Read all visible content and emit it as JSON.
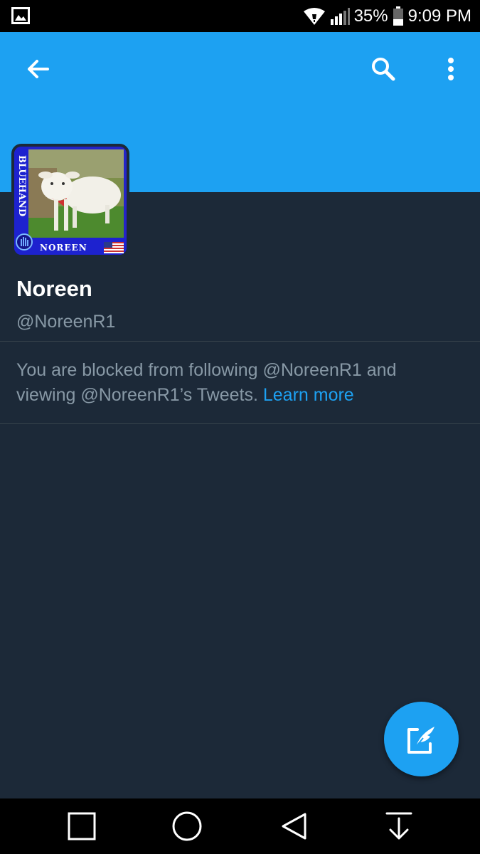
{
  "status_bar": {
    "battery_percent": "35%",
    "time": "9:09 PM",
    "icons": [
      "gallery-icon",
      "wifi-icon",
      "signal-icon",
      "battery-icon"
    ]
  },
  "header": {
    "color": "#1da1f2",
    "icons": [
      "back-arrow-icon",
      "search-icon",
      "more-vert-icon"
    ]
  },
  "profile": {
    "display_name": "Noreen",
    "handle": "@NoreenR1",
    "avatar": {
      "side_text": "BLUEHAND",
      "bottom_text": "NOREEN"
    }
  },
  "blocked_notice": {
    "message": "You are blocked from following @NoreenR1 and viewing @NoreenR1’s Tweets.",
    "link_text": "Learn more"
  },
  "fab": {
    "icon": "compose-tweet-icon"
  },
  "nav_bar": {
    "icons": [
      "recent-apps-icon",
      "home-icon",
      "back-icon",
      "notification-pull-icon"
    ]
  },
  "colors": {
    "background": "#1c2938",
    "accent": "#1da1f2",
    "secondary_text": "#8899a6",
    "divider": "#38444d"
  }
}
